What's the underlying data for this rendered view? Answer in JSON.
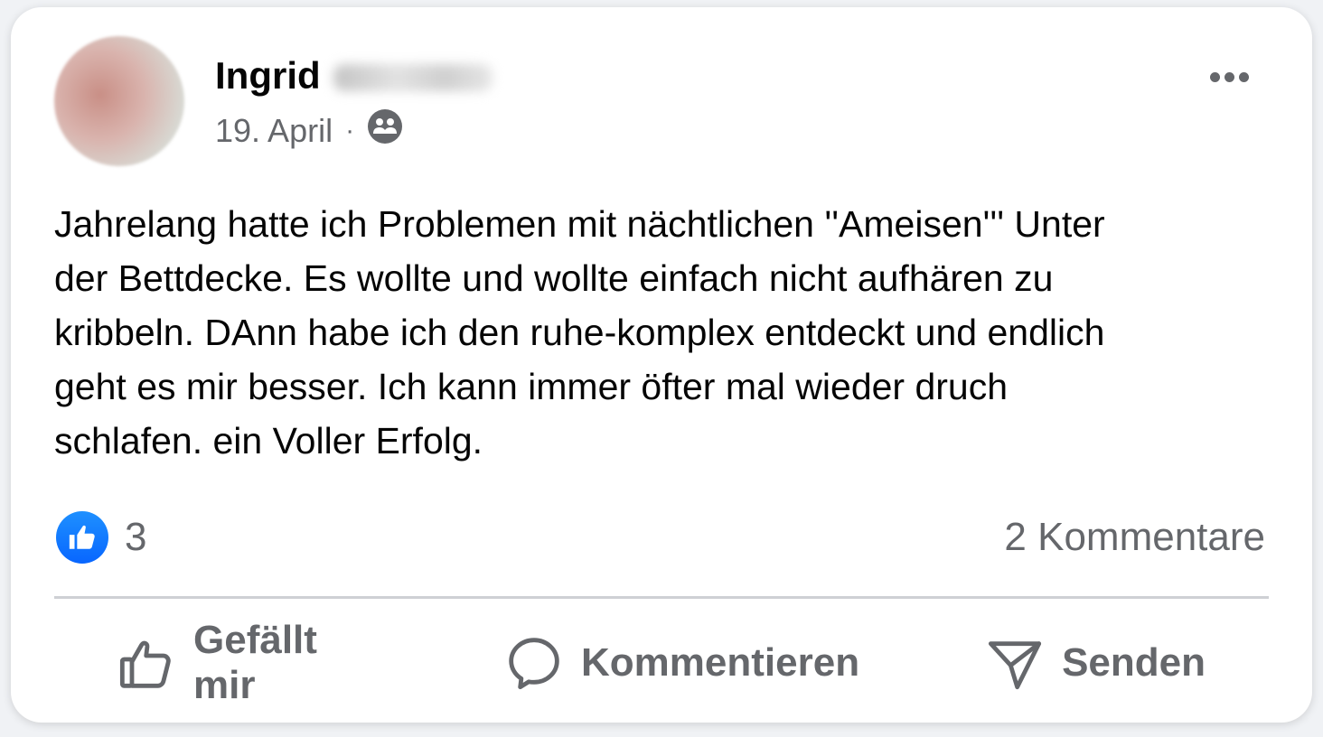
{
  "post": {
    "author_name": "Ingrid",
    "date": "19. April",
    "separator": "·",
    "audience_icon": "friends-icon",
    "text": "Jahrelang hatte ich Problemen mit nächtlichen ''Ameisen''' Unter\nder Bettdecke. Es wollte und wollte einfach nicht aufhären zu\nkribbeln. DAnn habe ich den ruhe-komplex entdeckt und endlich\ngeht es mir besser. Ich kann immer öfter mal wieder druch\nschlafen. ein Voller Erfolg.",
    "more_icon": "more-options-icon"
  },
  "stats": {
    "reaction_icon": "like-reaction-icon",
    "reaction_count": "3",
    "comments_label": "2 Kommentare"
  },
  "actions": {
    "like_label": "Gefällt mir",
    "comment_label": "Kommentieren",
    "send_label": "Senden"
  },
  "colors": {
    "like_blue": "#0866ff",
    "secondary_text": "#65676b",
    "primary_text": "#050505"
  }
}
